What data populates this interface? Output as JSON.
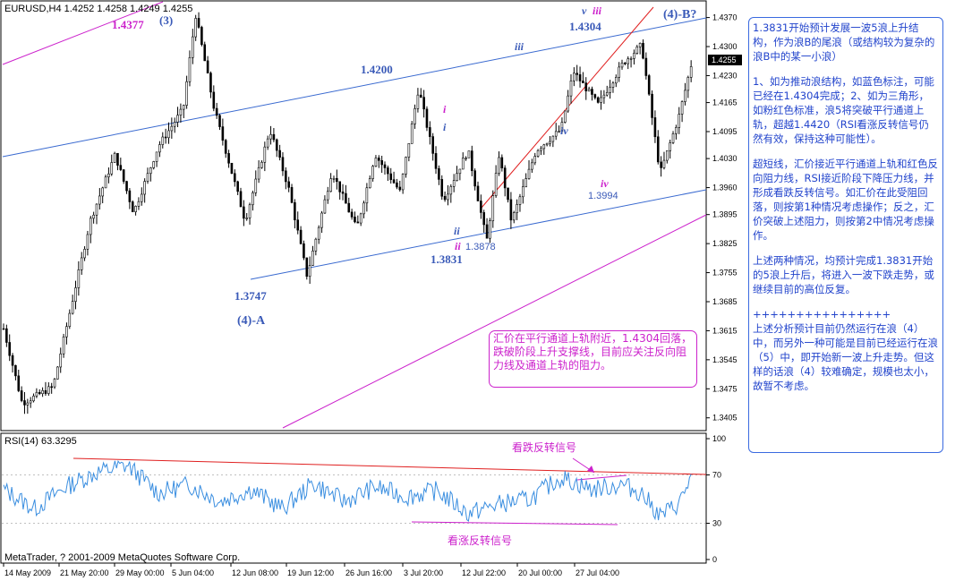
{
  "window": {
    "symbol_header": "EURUSD,H4  1.4252 1.4258 1.4249 1.4255",
    "last_price": "1.4255",
    "rsi_header": "RSI(14) 63.3295",
    "copyright": "MetaTrader, ? 2001-2009 MetaQuotes Software Corp."
  },
  "chart_data": [
    {
      "type": "candlestick",
      "symbol": "EURUSD",
      "timeframe": "H4",
      "ohlc": {
        "open": 1.4252,
        "high": 1.4258,
        "low": 1.4249,
        "close": 1.4255
      },
      "y_ticks": [
        "1.4370",
        "1.4300",
        "1.4230",
        "1.4165",
        "1.4095",
        "1.4030",
        "1.3960",
        "1.3895",
        "1.3825",
        "1.3755",
        "1.3685",
        "1.3615",
        "1.3545",
        "1.3475",
        "1.3405"
      ],
      "x_ticks": [
        "14 May 2009",
        "21 May 20:00",
        "29 May 00:00",
        "5 Jun 04:00",
        "12 Jun 08:00",
        "19 Jun 12:00",
        "26 Jun 16:00",
        "3 Jul 20:00",
        "12 Jul 22:00",
        "20 Jul 00:00",
        "27 Jul 04:00"
      ],
      "ylim": [
        1.3385,
        1.4395
      ],
      "key_points": [
        {
          "x": 0.0,
          "y": 1.362
        },
        {
          "x": 0.3,
          "y": 1.344
        },
        {
          "x": 0.8,
          "y": 1.348
        },
        {
          "x": 1.4,
          "y": 1.388
        },
        {
          "x": 1.8,
          "y": 1.404
        },
        {
          "x": 2.1,
          "y": 1.39
        },
        {
          "x": 2.5,
          "y": 1.406
        },
        {
          "x": 2.9,
          "y": 1.415
        },
        {
          "x": 3.1,
          "y": 1.4377
        },
        {
          "x": 3.4,
          "y": 1.415
        },
        {
          "x": 3.9,
          "y": 1.388
        },
        {
          "x": 4.3,
          "y": 1.41
        },
        {
          "x": 4.6,
          "y": 1.396
        },
        {
          "x": 4.9,
          "y": 1.3747
        },
        {
          "x": 5.3,
          "y": 1.4
        },
        {
          "x": 5.7,
          "y": 1.386
        },
        {
          "x": 6.0,
          "y": 1.404
        },
        {
          "x": 6.4,
          "y": 1.395
        },
        {
          "x": 6.7,
          "y": 1.42
        },
        {
          "x": 7.1,
          "y": 1.393
        },
        {
          "x": 7.5,
          "y": 1.405
        },
        {
          "x": 7.8,
          "y": 1.3831
        },
        {
          "x": 8.0,
          "y": 1.404
        },
        {
          "x": 8.2,
          "y": 1.3878
        },
        {
          "x": 8.6,
          "y": 1.405
        },
        {
          "x": 9.0,
          "y": 1.41
        },
        {
          "x": 9.2,
          "y": 1.424
        },
        {
          "x": 9.6,
          "y": 1.416
        },
        {
          "x": 10.0,
          "y": 1.426
        },
        {
          "x": 10.3,
          "y": 1.4304
        },
        {
          "x": 10.6,
          "y": 1.3994
        },
        {
          "x": 10.9,
          "y": 1.413
        },
        {
          "x": 11.1,
          "y": 1.4255
        }
      ],
      "price_labels": [
        "1.4377",
        "1.4200",
        "1.4304",
        "1.3747",
        "1.3831",
        "1.3878",
        "1.3994"
      ],
      "wave_labels": [
        "(3)",
        "(4)-B?",
        "(4)-A",
        "i",
        "i",
        "ii",
        "ii",
        "iii",
        "iii",
        "iv",
        "iv",
        "v"
      ]
    },
    {
      "type": "line",
      "name": "RSI(14)",
      "current": 63.3295,
      "y_ticks": [
        "100",
        "70",
        "30",
        "0"
      ],
      "ylim": [
        0,
        100
      ],
      "x": [
        0,
        0.5,
        1,
        1.5,
        2,
        2.5,
        3,
        3.5,
        4,
        4.5,
        5,
        5.5,
        6,
        6.5,
        7,
        7.5,
        8,
        8.5,
        9,
        9.5,
        10,
        10.3,
        10.6,
        10.9,
        11.1
      ],
      "values": [
        58,
        42,
        60,
        72,
        78,
        55,
        62,
        48,
        58,
        42,
        63,
        48,
        60,
        52,
        57,
        38,
        46,
        50,
        68,
        58,
        62,
        55,
        36,
        46,
        68
      ],
      "annotations": [
        "看跌反转信号",
        "看涨反转信号"
      ]
    }
  ],
  "notes": {
    "chart_box": "汇价在平行通道上轨附近，1.4304回落，跌破阶段上升支撑线，目前应关注反向阻力线及通道上轨的阻力。",
    "side_paragraphs": [
      "1.3831开始预计发展一波5浪上升结构，作为浪B的尾浪（或结构较为复杂的浪B中的某一小浪）",
      "1、如为推动浪结构，如蓝色标注，可能已经在1.4304完成；2、如为三角形，如粉红色标准，浪5将突破平行通道上轨，超越1.4420（RSI看涨反转信号仍然有效，保持这种可能性）。",
      "超短线，汇价接近平行通道上轨和红色反向阻力线，RSI接近阶段下降压力线，并形成看跌反转信号。如汇价在此受阻回落，则按第1种情况考虑操作；反之，汇价突破上述阻力，则按第2中情况考虑操作。",
      "上述两种情况，均预计完成1.3831开始的5浪上升后，将进入一波下跌走势，或继续目前的高位反复。",
      "++++++++++++++++",
      "上述分析预计目前仍然运行在浪（4）中，而另外一种可能是目前已经运行在浪（5）中，即开始新一波上升走势。但这样的话浪（4）较难确定，规模也太小，故暂不考虑。"
    ]
  },
  "colors": {
    "candle": "#000000",
    "channel": "#3a6ad0",
    "resistance": "#e02020",
    "magenta": "#cc22cc",
    "rsi": "#3a8ee0"
  }
}
